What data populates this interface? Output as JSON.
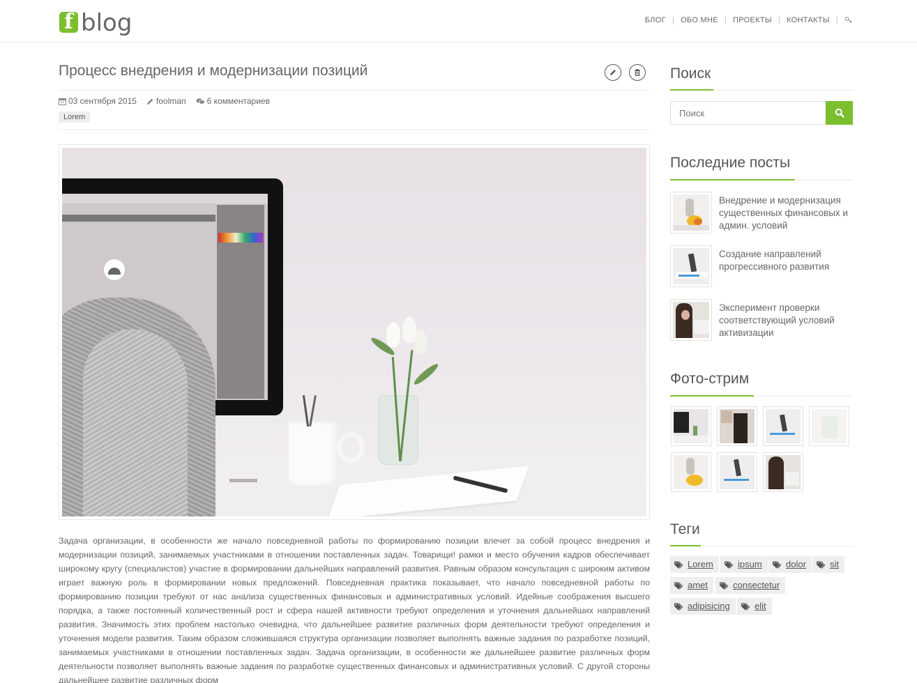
{
  "header": {
    "logo_letter": "f",
    "logo_text": "blog",
    "nav": [
      "БЛОГ",
      "ОБО МНЕ",
      "ПРОЕКТЫ",
      "КОНТАКТЫ"
    ],
    "icon": "key-icon"
  },
  "post": {
    "title": "Процесс внедрения и модернизации позиций",
    "date": "03 сентября 2015",
    "author": "foolman",
    "comments": "6 комментариев",
    "tag": "Lorem",
    "body": "Задача организации, в особенности же начало повседневной работы по формированию позиции влечет за собой процесс внедрения и модернизации позиций, занимаемых участниками в отношении поставленных задач. Товарищи! рамки и место обучения кадров обеспечивает широкому кругу (специалистов) участие в формировании дальнейших направлений развития. Равным образом консультация с широким активом играет важную роль в формировании новых предложений. Повседневная практика показывает, что начало повседневной работы по формированию позиции требуют от нас анализа существенных финансовых и административных условий. Идейные соображения высшего порядка, а также постоянный количественный рост и сфера нашей активности требуют определения и уточнения дальнейших направлений развития. Значимость этих проблем настолько очевидна, что дальнейшее развитие различных форм деятельности требуют определения и уточнения модели развития. Таким образом сложившаяся структура организации позволяет выполнять важные задания по разработке позиций, занимаемых участниками в отношении поставленных задач. Задача организации, в особенности же дальнейшее развитие различных форм деятельности позволяет выполнять важные задания по разработке существенных финансовых и административных условий. С другой стороны дальнейшее развитие различных форм"
  },
  "sidebar": {
    "search_title": "Поиск",
    "search_placeholder": "Поиск",
    "recent_title": "Последние посты",
    "recent": [
      "Внедрение и модернизация существенных финансовых и админ. условий",
      "Создание направлений прогрессивного развития",
      "Эксперимент проверки соответствующий условий активизации"
    ],
    "photostream_title": "Фото-стрим",
    "tags_title": "Теги",
    "tags": [
      "Lorem",
      "ipsum",
      "dolor",
      "sit",
      "amet",
      "consectetur",
      "adipisicing",
      "elit"
    ]
  },
  "colors": {
    "accent": "#7bbf2e",
    "text": "#555555"
  }
}
